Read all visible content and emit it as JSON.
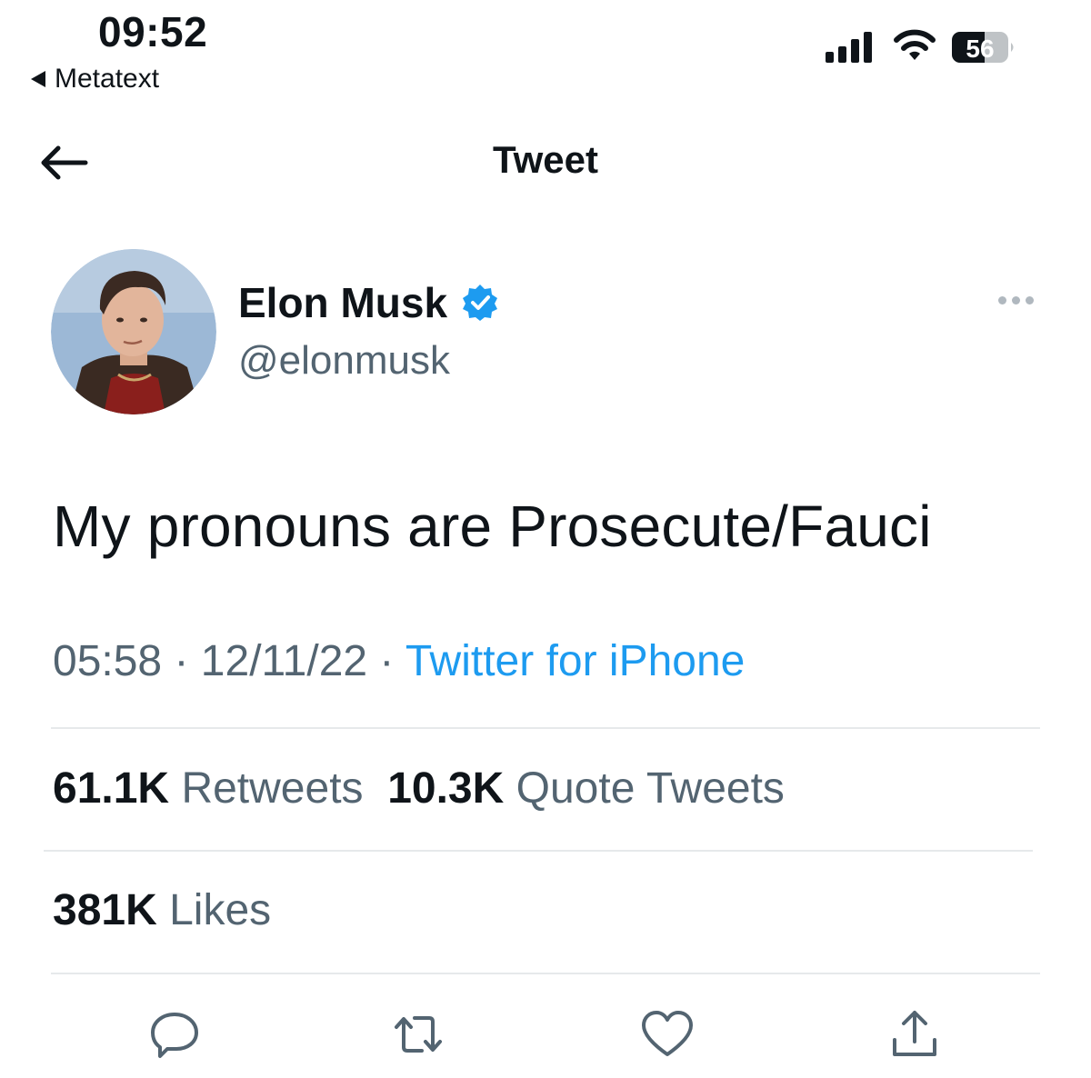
{
  "status_bar": {
    "time": "09:52",
    "back_app": "Metatext",
    "battery": "56"
  },
  "header": {
    "title": "Tweet"
  },
  "tweet": {
    "author_name": "Elon Musk",
    "handle": "@elonmusk",
    "text": "My pronouns are Prosecute/Fauci",
    "time": "05:58",
    "date": "12/11/22",
    "source": "Twitter for iPhone",
    "separator": "·"
  },
  "stats": {
    "retweets_count": "61.1K",
    "retweets_label": "Retweets",
    "quotes_count": "10.3K",
    "quotes_label": "Quote Tweets",
    "likes_count": "381K",
    "likes_label": "Likes"
  },
  "colors": {
    "link": "#1d9bf0",
    "verified": "#1d9bf0",
    "secondary_text": "#536471"
  },
  "icons": {
    "back": "back-arrow-icon",
    "verified": "verified-badge-icon",
    "more": "more-dots-icon",
    "reply": "reply-icon",
    "retweet": "retweet-icon",
    "like": "heart-icon",
    "share": "share-icon"
  }
}
